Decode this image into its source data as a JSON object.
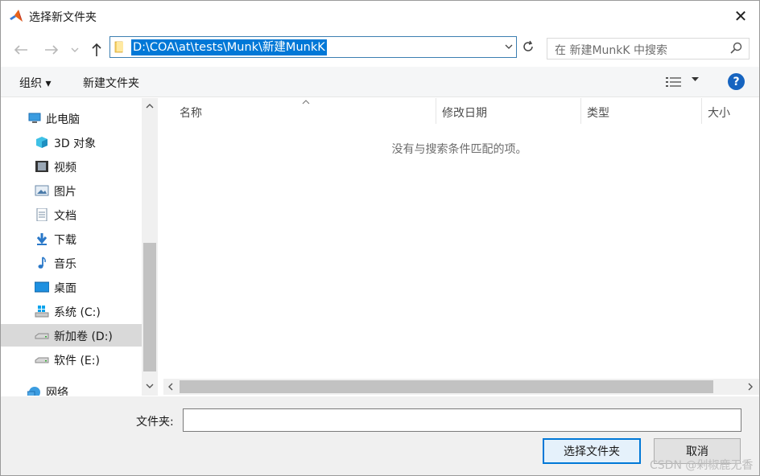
{
  "window": {
    "title": "选择新文件夹",
    "close_glyph": "✕"
  },
  "address_bar": {
    "path": "D:\\COA\\at\\tests\\Munk\\新建MunkK",
    "search_placeholder": "在 新建MunkK 中搜索"
  },
  "toolbar": {
    "organize_label": "组织 ▾",
    "new_folder_label": "新建文件夹",
    "help_label": "?"
  },
  "sidebar": {
    "items": [
      {
        "label": "此电脑",
        "icon": "pc-icon"
      },
      {
        "label": "3D 对象",
        "icon": "3d-objects-icon"
      },
      {
        "label": "视频",
        "icon": "video-icon"
      },
      {
        "label": "图片",
        "icon": "pictures-icon"
      },
      {
        "label": "文档",
        "icon": "documents-icon"
      },
      {
        "label": "下载",
        "icon": "download-icon"
      },
      {
        "label": "音乐",
        "icon": "music-icon"
      },
      {
        "label": "桌面",
        "icon": "desktop-icon"
      },
      {
        "label": "系统 (C:)",
        "icon": "system-drive-icon"
      },
      {
        "label": "新加卷 (D:)",
        "icon": "drive-icon",
        "selected": true
      },
      {
        "label": "软件 (E:)",
        "icon": "drive-icon"
      },
      {
        "label": "网络",
        "icon": "network-icon"
      }
    ]
  },
  "file_list": {
    "columns": [
      "名称",
      "修改日期",
      "类型",
      "大小"
    ],
    "empty_message": "没有与搜索条件匹配的项。"
  },
  "footer": {
    "folder_label": "文件夹:",
    "folder_value": "",
    "select_button": "选择文件夹",
    "cancel_button": "取消"
  },
  "watermark": "CSDN @剁椒鹿无香"
}
